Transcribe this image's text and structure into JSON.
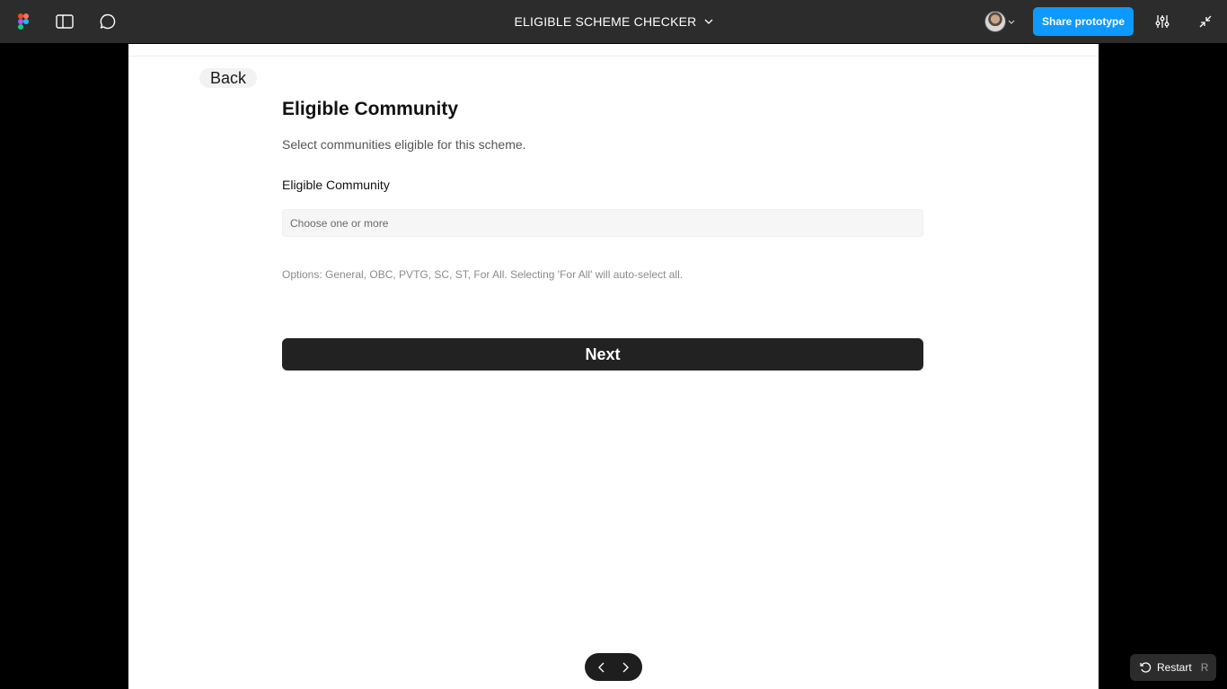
{
  "toolbar": {
    "file_title": "ELIGIBLE SCHEME CHECKER",
    "share_label": "Share prototype",
    "icons": [
      "figma-logo-icon",
      "sidebar-panel-icon",
      "comment-icon",
      "chevron-down-icon",
      "avatar",
      "settings-sliders-icon",
      "collapse-icon"
    ]
  },
  "screen": {
    "back_label": "Back",
    "heading": "Eligible Community",
    "subtext": "Select communities eligible for this scheme.",
    "field_label": "Eligible Community",
    "field_placeholder": "Choose one or more",
    "hint": "Options: General, OBC, PVTG, SC, ST, For All. Selecting 'For All' will auto-select all.",
    "next_label": "Next"
  },
  "footer": {
    "restart_label": "Restart",
    "restart_shortcut": "R"
  },
  "colors": {
    "toolbar_bg": "#2c2c2c",
    "share_button": "#0d99ff",
    "next_button": "#222222",
    "canvas_bg": "#000000"
  }
}
